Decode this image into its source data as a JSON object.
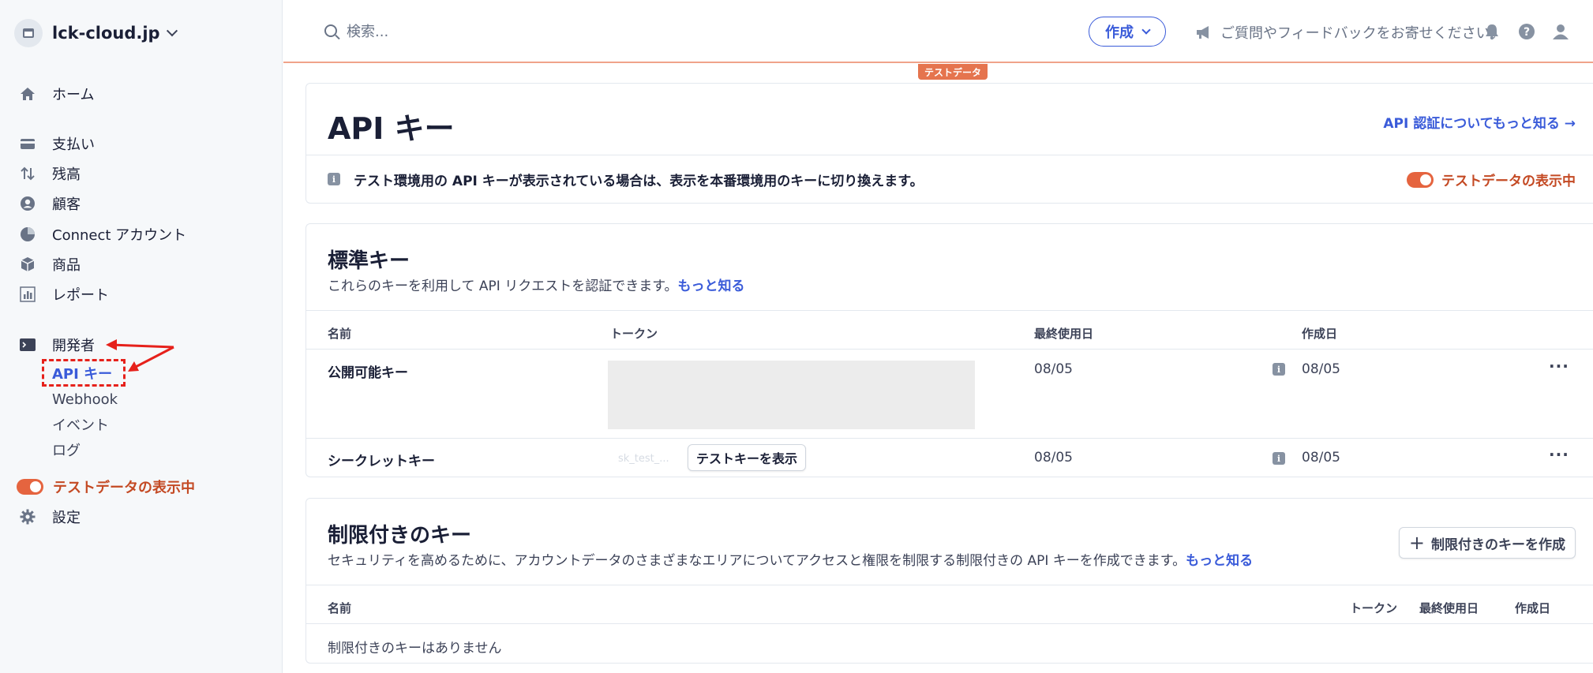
{
  "sidebar": {
    "account_name": "lck-cloud.jp",
    "items": [
      {
        "label": "ホーム",
        "icon": "home-icon"
      },
      {
        "label": "支払い",
        "icon": "payments-icon"
      },
      {
        "label": "残高",
        "icon": "balance-icon"
      },
      {
        "label": "顧客",
        "icon": "customers-icon"
      },
      {
        "label": "Connect アカウント",
        "icon": "connect-icon"
      },
      {
        "label": "商品",
        "icon": "products-icon"
      },
      {
        "label": "レポート",
        "icon": "reports-icon"
      },
      {
        "label": "開発者",
        "icon": "terminal-icon"
      }
    ],
    "dev_subitems": [
      "API キー",
      "Webhook",
      "イベント",
      "ログ"
    ],
    "test_toggle_label": "テストデータの表示中",
    "settings_label": "設定"
  },
  "topbar": {
    "search_placeholder": "検索...",
    "create_label": "作成",
    "feedback_label": "ご質問やフィードバックをお寄せください。",
    "test_badge": "テストデータ"
  },
  "header_card": {
    "title": "API キー",
    "learn_link": "API 認証についてもっと知る →",
    "notice": "テスト環境用の API キーが表示されている場合は、表示を本番環境用のキーに切り換えます。",
    "toggle_label": "テストデータの表示中"
  },
  "standard_keys": {
    "title": "標準キー",
    "description": "これらのキーを利用して API リクエストを認証できます。",
    "learn_more": "もっと知る",
    "columns": [
      "名前",
      "トークン",
      "最終使用日",
      "作成日"
    ],
    "rows": [
      {
        "name": "公開可能キー",
        "last_used": "08/05",
        "created": "08/05"
      },
      {
        "name": "シークレットキー",
        "token_hint": "sk_test_...",
        "reveal_label": "テストキーを表示",
        "last_used": "08/05",
        "created": "08/05"
      }
    ]
  },
  "restricted_keys": {
    "title": "制限付きのキー",
    "description": "セキュリティを高めるために、アカウントデータのさまざまなエリアについてアクセスと権限を制限する制限付きの API キーを作成できます。",
    "learn_more": "もっと知る",
    "create_button": "制限付きのキーを作成",
    "columns": [
      "名前",
      "トークン",
      "最終使用日",
      "作成日"
    ],
    "empty_text": "制限付きのキーはありません"
  },
  "colors": {
    "accent": "#3a5bd9",
    "test_orange": "#e5643f"
  }
}
